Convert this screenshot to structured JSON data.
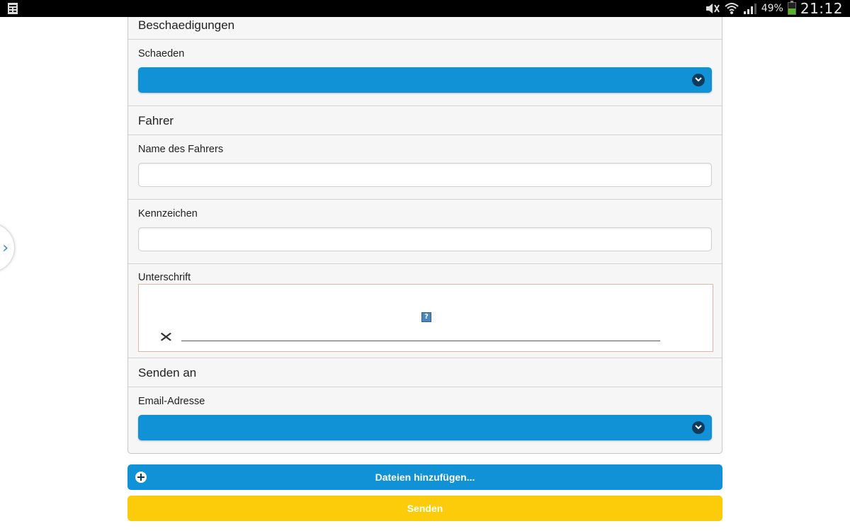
{
  "status_bar": {
    "battery": "49%",
    "time": "21:12"
  },
  "sections": {
    "damages": {
      "title": "Beschaedigungen",
      "field_label": "Schaeden",
      "value": ""
    },
    "driver": {
      "title": "Fahrer",
      "name_label": "Name des Fahrers",
      "name_value": "",
      "plate_label": "Kennzeichen",
      "plate_value": "",
      "signature_label": "Unterschrift",
      "signature_help": "?",
      "signature_x": "✕"
    },
    "send_to": {
      "title": "Senden an",
      "field_label": "Email-Adresse",
      "value": ""
    }
  },
  "buttons": {
    "add_files": "Dateien hinzufügen...",
    "send": "Senden"
  },
  "colors": {
    "primary": "#1191d6",
    "send": "#fccc0a",
    "statusbar": "#000000"
  },
  "icons": [
    "document-icon",
    "mute-icon",
    "wifi-icon",
    "signal-icon",
    "battery-icon",
    "chevron-right-icon",
    "chevron-down-icon",
    "help-icon",
    "plus-circle-icon"
  ]
}
